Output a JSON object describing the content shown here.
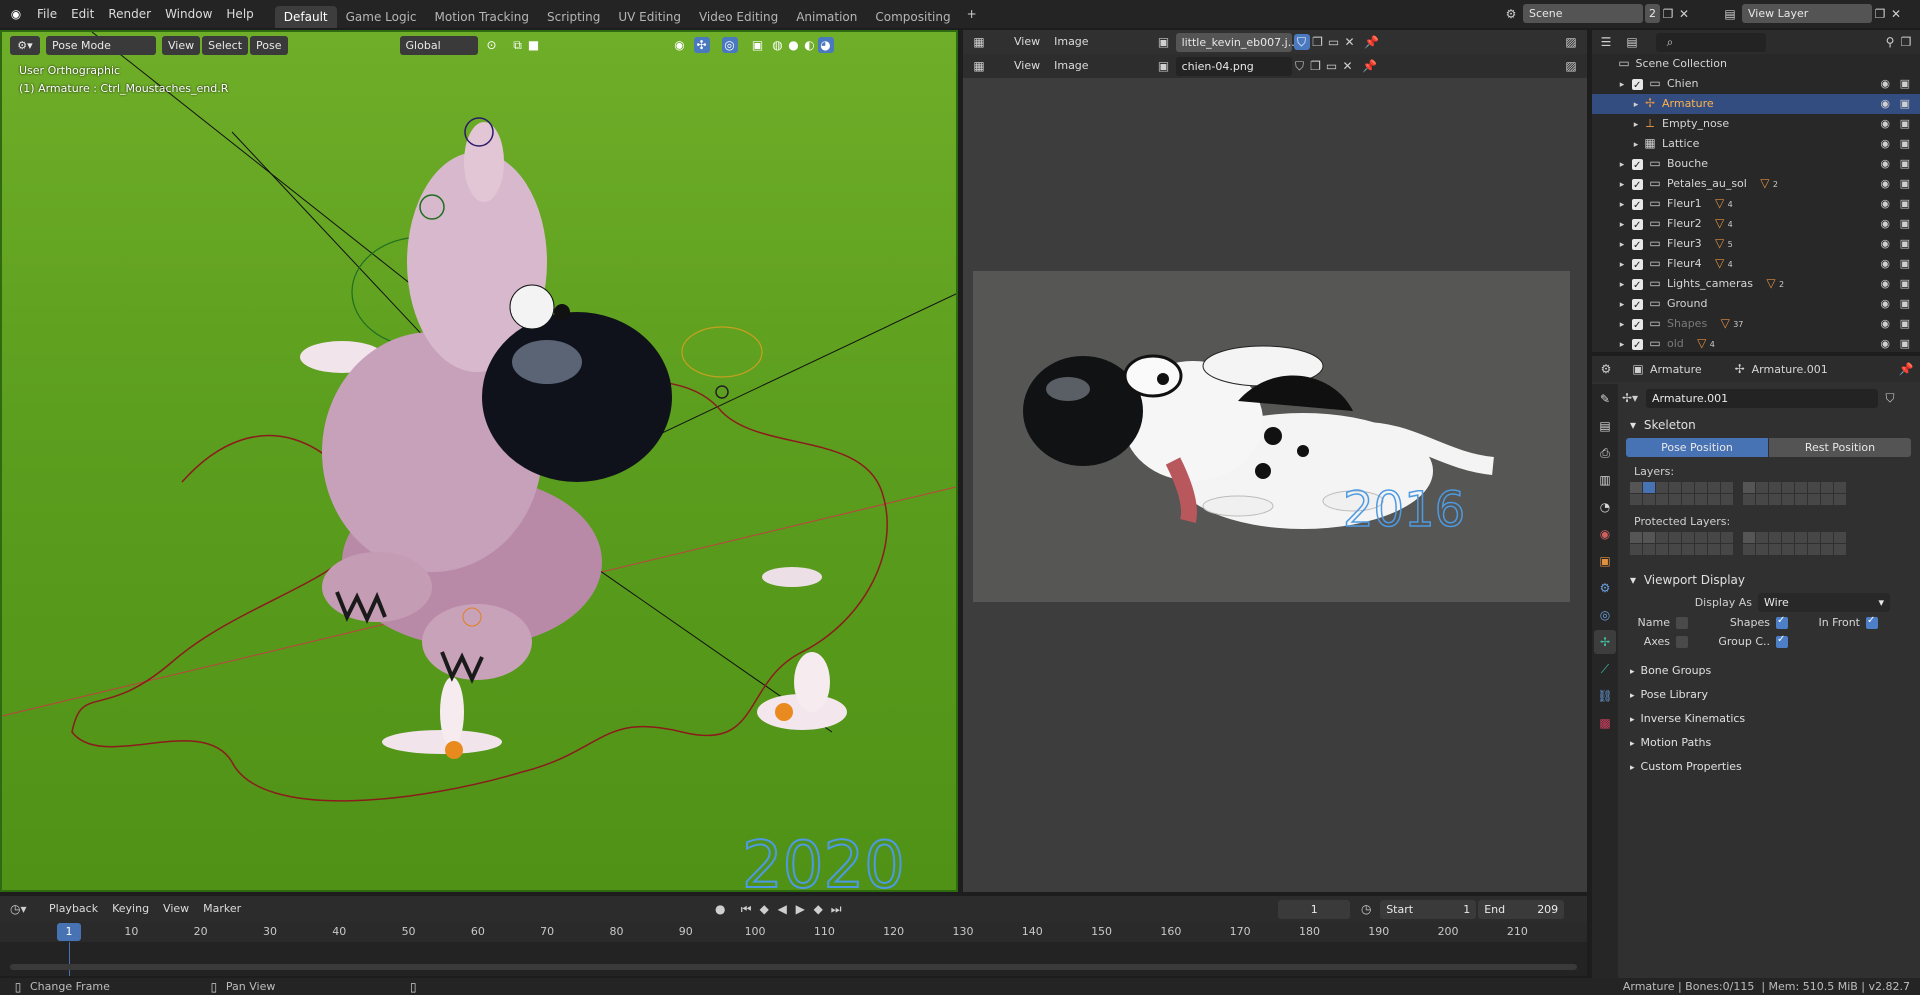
{
  "topbar": {
    "menus": [
      "File",
      "Edit",
      "Render",
      "Window",
      "Help"
    ],
    "workspaces": [
      "Default",
      "Game Logic",
      "Motion Tracking",
      "Scripting",
      "UV Editing",
      "Video Editing",
      "Animation",
      "Compositing"
    ],
    "active_workspace": "Default",
    "scene_name": "Scene",
    "scene_users": "2",
    "view_layer": "View Layer"
  },
  "viewport": {
    "mode": "Pose Mode",
    "menus": [
      "View",
      "Select",
      "Pose"
    ],
    "transform_orientation": "Global",
    "view_name": "User Orthographic",
    "active_info": "(1) Armature : Ctrl_Moustaches_end.R",
    "signature": "2020"
  },
  "image_editor": {
    "header1": {
      "menus": [
        "View",
        "Image"
      ],
      "image_name": "little_kevin_eb007.j..."
    },
    "header2": {
      "menus": [
        "View",
        "Image"
      ],
      "image_name": "chien-04.png"
    },
    "signature": "2016"
  },
  "outliner": {
    "root": "Scene Collection",
    "items": [
      {
        "name": "Chien",
        "indent": 1,
        "type": "collection"
      },
      {
        "name": "Armature",
        "indent": 2,
        "type": "armature",
        "selected": true
      },
      {
        "name": "Empty_nose",
        "indent": 2,
        "type": "empty"
      },
      {
        "name": "Lattice",
        "indent": 2,
        "type": "lattice"
      },
      {
        "name": "Bouche",
        "indent": 1,
        "type": "collection"
      },
      {
        "name": "Petales_au_sol",
        "indent": 1,
        "type": "collection",
        "badge": "2"
      },
      {
        "name": "Fleur1",
        "indent": 1,
        "type": "collection",
        "badge": "4"
      },
      {
        "name": "Fleur2",
        "indent": 1,
        "type": "collection",
        "badge": "4"
      },
      {
        "name": "Fleur3",
        "indent": 1,
        "type": "collection",
        "badge": "5"
      },
      {
        "name": "Fleur4",
        "indent": 1,
        "type": "collection",
        "badge": "4"
      },
      {
        "name": "Lights_cameras",
        "indent": 1,
        "type": "collection",
        "badge": "2"
      },
      {
        "name": "Ground",
        "indent": 1,
        "type": "collection"
      },
      {
        "name": "Shapes",
        "indent": 1,
        "type": "collection",
        "badge": "37",
        "dim": true
      },
      {
        "name": "old",
        "indent": 1,
        "type": "collection",
        "badge": "4",
        "dim": true
      }
    ]
  },
  "properties": {
    "context_object": "Armature",
    "context_data": "Armature.001",
    "data_name": "Armature.001",
    "skeleton": {
      "title": "Skeleton",
      "pose_position": "Pose Position",
      "rest_position": "Rest Position",
      "layers_label": "Layers:",
      "protected_label": "Protected Layers:"
    },
    "viewport_display": {
      "title": "Viewport Display",
      "display_as_label": "Display As",
      "display_as_value": "Wire",
      "name_label": "Name",
      "shapes_label": "Shapes",
      "in_front_label": "In Front",
      "axes_label": "Axes",
      "group_label": "Group C.."
    },
    "collapsed_panels": [
      "Bone Groups",
      "Pose Library",
      "Inverse Kinematics",
      "Motion Paths",
      "Custom Properties"
    ]
  },
  "timeline": {
    "menus": [
      "Playback",
      "Keying",
      "View",
      "Marker"
    ],
    "current_frame": "1",
    "start_label": "Start",
    "start": "1",
    "end_label": "End",
    "end": "209",
    "ticks": [
      "1",
      "10",
      "20",
      "30",
      "40",
      "50",
      "60",
      "70",
      "80",
      "90",
      "100",
      "110",
      "120",
      "130",
      "140",
      "150",
      "160",
      "170",
      "180",
      "190",
      "200",
      "210"
    ]
  },
  "statusbar": {
    "left1": "Change Frame",
    "left2": "Pan View",
    "right": "Armature | Bones:0/115  | Mem: 510.5 MiB | v2.82.7"
  }
}
